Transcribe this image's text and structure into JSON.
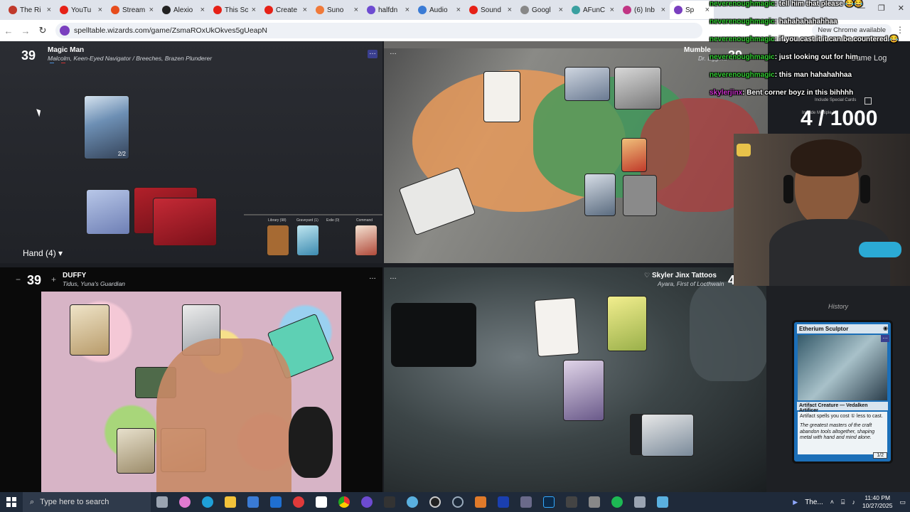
{
  "browser": {
    "tabs": [
      {
        "title": "The Ri",
        "color": "#c0392b"
      },
      {
        "title": "YouTu",
        "color": "#e62117"
      },
      {
        "title": "Stream",
        "color": "#e74c1c"
      },
      {
        "title": "Alexio",
        "color": "#222222"
      },
      {
        "title": "This Sc",
        "color": "#e62117"
      },
      {
        "title": "Create",
        "color": "#e62117"
      },
      {
        "title": "Suno",
        "color": "#f07a3a"
      },
      {
        "title": "halfdn",
        "color": "#6d4bd1"
      },
      {
        "title": "Audio",
        "color": "#3a7bd5"
      },
      {
        "title": "Sound",
        "color": "#e62117"
      },
      {
        "title": "Googl",
        "color": "#888888"
      },
      {
        "title": "AFunC",
        "color": "#3aa0a0"
      },
      {
        "title": "(6) Inb",
        "color": "#c13584"
      },
      {
        "title": "Sp",
        "color": "#7a3fbf"
      }
    ],
    "url": "spelltable.wizards.com/game/ZsmaROxUkOkves5gUeapN",
    "new_chrome": "New Chrome available"
  },
  "players": {
    "p1": {
      "life": "39",
      "name": "Magic Man",
      "commander": "Malcolm, Keen-Eyed Navigator / Breeches, Brazen Plunderer",
      "hand": "Hand (4) ▾",
      "card_count": "2/2"
    },
    "p2": {
      "life": "39",
      "name": "Mumble",
      "commander": "Dr. Eggma"
    },
    "p3": {
      "life": "39",
      "name": "DUFFY",
      "commander": "Tidus, Yuna's Guardian"
    },
    "p4": {
      "life": "4",
      "name": "Skyler Jinx Tattoos",
      "commander": "Ayara, First of Locthwain"
    }
  },
  "zones": [
    "Library (98)",
    "Graveyard (1)",
    "Exile (0)",
    "Command"
  ],
  "chat": [
    {
      "user": "neverenoughmagic",
      "text": ": tell him that please 😂😂"
    },
    {
      "user": "neverenoughmagic",
      "text": ": hahahahahahhaa"
    },
    {
      "user": "neverenoughmagic",
      "text": ": if you cast it it can be countered 😂"
    },
    {
      "user": "neverenoughmagic",
      "text": ": just looking out for him"
    },
    {
      "user": "neverenoughmagic",
      "text": ": this man hahahahhaa"
    },
    {
      "user": "skylerjinx",
      "text": ": Bent corner boyz in this bihhhh"
    }
  ],
  "overlay": {
    "counter": "4 / 1000",
    "game_log": "Game Log",
    "include_special": "Include Special Cards",
    "include_multiple": "Include Multiple La"
  },
  "history": {
    "title": "History",
    "card": {
      "name": "Etherium Sculptor",
      "type": "Artifact Creature — Vedalken Artificer",
      "rules": "Artifact spells you cost ① less to cast.",
      "flavor": "The greatest masters of the craft abandon tools altogether, shaping metal with hand and mind alone.",
      "pt": "1/2"
    }
  },
  "taskbar": {
    "search_placeholder": "Type here to search",
    "media": "The...",
    "time": "11:40 PM",
    "date": "10/27/2025"
  }
}
